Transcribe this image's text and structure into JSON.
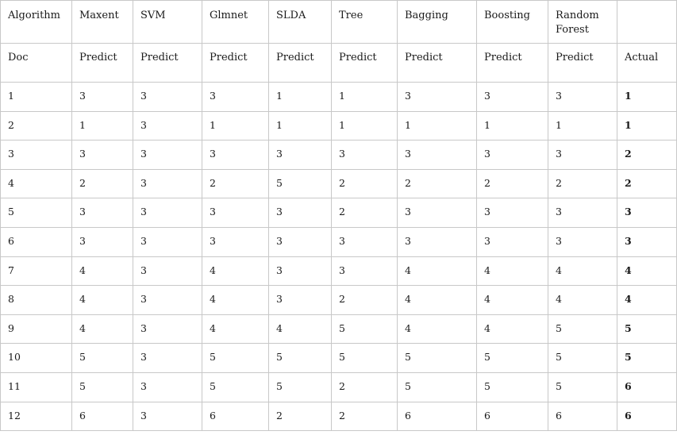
{
  "table": {
    "algorithm_row": [
      "Algorithm",
      "Maxent",
      "SVM",
      "Glmnet",
      "SLDA",
      "Tree",
      "Bagging",
      "Boosting",
      "Random Forest",
      ""
    ],
    "subheader_row": [
      "Doc",
      "Predict",
      "Predict",
      "Predict",
      "Predict",
      "Predict",
      "Predict",
      "Predict",
      "Predict",
      "Actual"
    ],
    "rows": [
      [
        "1",
        "3",
        "3",
        "3",
        "1",
        "1",
        "3",
        "3",
        "3",
        "1"
      ],
      [
        "2",
        "1",
        "3",
        "1",
        "1",
        "1",
        "1",
        "1",
        "1",
        "1"
      ],
      [
        "3",
        "3",
        "3",
        "3",
        "3",
        "3",
        "3",
        "3",
        "3",
        "2"
      ],
      [
        "4",
        "2",
        "3",
        "2",
        "5",
        "2",
        "2",
        "2",
        "2",
        "2"
      ],
      [
        "5",
        "3",
        "3",
        "3",
        "3",
        "2",
        "3",
        "3",
        "3",
        "3"
      ],
      [
        "6",
        "3",
        "3",
        "3",
        "3",
        "3",
        "3",
        "3",
        "3",
        "3"
      ],
      [
        "7",
        "4",
        "3",
        "4",
        "3",
        "3",
        "4",
        "4",
        "4",
        "4"
      ],
      [
        "8",
        "4",
        "3",
        "4",
        "3",
        "2",
        "4",
        "4",
        "4",
        "4"
      ],
      [
        "9",
        "4",
        "3",
        "4",
        "4",
        "5",
        "4",
        "4",
        "5",
        "5"
      ],
      [
        "10",
        "5",
        "3",
        "5",
        "5",
        "5",
        "5",
        "5",
        "5",
        "5"
      ],
      [
        "11",
        "5",
        "3",
        "5",
        "5",
        "2",
        "5",
        "5",
        "5",
        "6"
      ],
      [
        "12",
        "6",
        "3",
        "6",
        "2",
        "2",
        "6",
        "6",
        "6",
        "6"
      ]
    ]
  }
}
